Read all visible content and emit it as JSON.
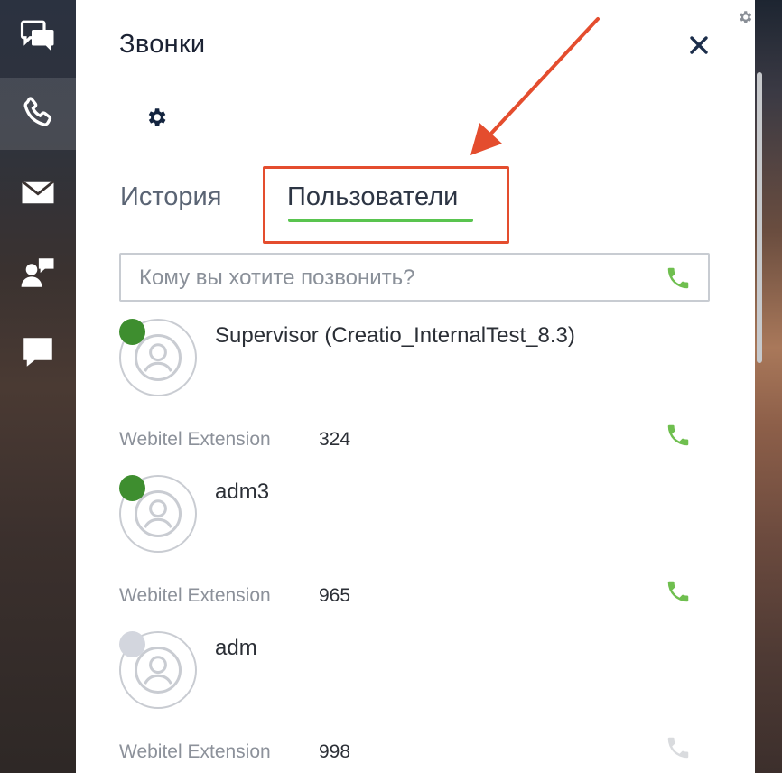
{
  "panel": {
    "title": "Звонки",
    "close_label": "close"
  },
  "tabs": [
    {
      "label": "История",
      "active": false
    },
    {
      "label": "Пользователи",
      "active": true
    }
  ],
  "search": {
    "placeholder": "Кому вы хотите позвонить?",
    "value": ""
  },
  "users": [
    {
      "name": "Supervisor (Creatio_InternalTest_8.3)",
      "ext_label": "Webitel Extension",
      "ext_number": "324",
      "status": "online",
      "status_color": "#3e8e2f",
      "call_color": "#6fbf4f"
    },
    {
      "name": "adm3",
      "ext_label": "Webitel Extension",
      "ext_number": "965",
      "status": "online",
      "status_color": "#3e8e2f",
      "call_color": "#6fbf4f"
    },
    {
      "name": "adm",
      "ext_label": "Webitel Extension",
      "ext_number": "998",
      "status": "offline",
      "status_color": "#d3d6de",
      "call_color": "#d9dbde"
    }
  ],
  "rail": {
    "items": [
      {
        "icon": "chats-icon",
        "active": false
      },
      {
        "icon": "phone-icon",
        "active": true
      },
      {
        "icon": "mail-icon",
        "active": false
      },
      {
        "icon": "contact-message-icon",
        "active": false
      },
      {
        "icon": "message-icon",
        "active": false
      }
    ]
  },
  "colors": {
    "accent_green": "#59c44f",
    "highlight_red": "#e44d2e",
    "online": "#3e8e2f",
    "offline": "#d3d6de"
  }
}
